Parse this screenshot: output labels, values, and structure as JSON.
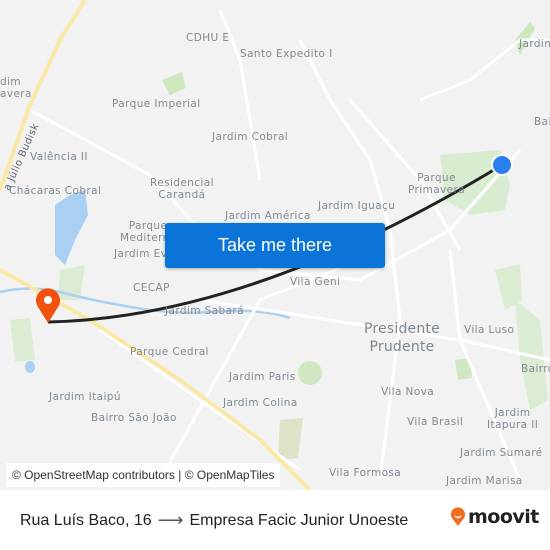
{
  "map": {
    "labels": [
      {
        "id": "cdhu-e",
        "text": "CDHU E"
      },
      {
        "id": "santo-expedito",
        "text": "Santo Expedito I"
      },
      {
        "id": "jardim-d-top-right",
        "text": "Jardim d"
      },
      {
        "id": "jardim-primavera-left",
        "text": "dim\navera"
      },
      {
        "id": "parque-imperial",
        "text": "Parque Imperial"
      },
      {
        "id": "bai-right",
        "text": "Bai"
      },
      {
        "id": "jardim-cobral",
        "text": "Jardim Cobral"
      },
      {
        "id": "valencia-ii",
        "text": "Valência II"
      },
      {
        "id": "residencial-caranda",
        "text": "Residencial\nCarandá"
      },
      {
        "id": "parque-primavera",
        "text": "Parque\nPrimavera"
      },
      {
        "id": "chacaras-cobral",
        "text": "Chácaras Cobral"
      },
      {
        "id": "jardim-america",
        "text": "Jardim América"
      },
      {
        "id": "jardim-iguacu",
        "text": "Jardim Iguaçu"
      },
      {
        "id": "parque-mediterraneo",
        "text": "Parque\nMediterr"
      },
      {
        "id": "jardim-ev",
        "text": "Jardim Ev"
      },
      {
        "id": "cecap",
        "text": "CECAP"
      },
      {
        "id": "vila-geni",
        "text": "Vila Geni"
      },
      {
        "id": "jardim-sabara",
        "text": "Jardim Sabará"
      },
      {
        "id": "presidente-prudente",
        "text": "Presidente\nPrudente"
      },
      {
        "id": "vila-luso",
        "text": "Vila Luso"
      },
      {
        "id": "parque-cedral",
        "text": "Parque Cedral"
      },
      {
        "id": "bairro-right",
        "text": "Bairro"
      },
      {
        "id": "jardim-paris",
        "text": "Jardim Paris"
      },
      {
        "id": "vila-nova",
        "text": "Vila Nova"
      },
      {
        "id": "jardim-itaipu",
        "text": "Jardim Itaipú"
      },
      {
        "id": "jardim-colina",
        "text": "Jardim Colina"
      },
      {
        "id": "bairro-sao-joao",
        "text": "Bairro São João"
      },
      {
        "id": "vila-brasil",
        "text": "Vila Brasil"
      },
      {
        "id": "jardim-itapura-ii",
        "text": "Jardim\nItapura II"
      },
      {
        "id": "jardim-sumare",
        "text": "Jardim Sumaré"
      },
      {
        "id": "vila-formosa",
        "text": "Vila Formosa"
      },
      {
        "id": "jardim-marisa",
        "text": "Jardim Marisa"
      }
    ],
    "road_label": "a Júlio Budisk",
    "cta_label": "Take me there",
    "attribution": "© OpenStreetMap contributors | © OpenMapTiles",
    "colors": {
      "origin_marker": "#2a7ff0",
      "destination_marker": "#f1520f",
      "route_line": "#222222",
      "cta_background": "#0b74d9",
      "highway": "#fbe8a6",
      "water": "#a9d0f3",
      "park": "#d8ecd0"
    }
  },
  "footer": {
    "origin": "Rua Luís Baco, 16",
    "arrow": "⟶",
    "destination": "Empresa Facic Junior Unoeste",
    "brand": "moovit",
    "brand_color": "#f26b21"
  }
}
